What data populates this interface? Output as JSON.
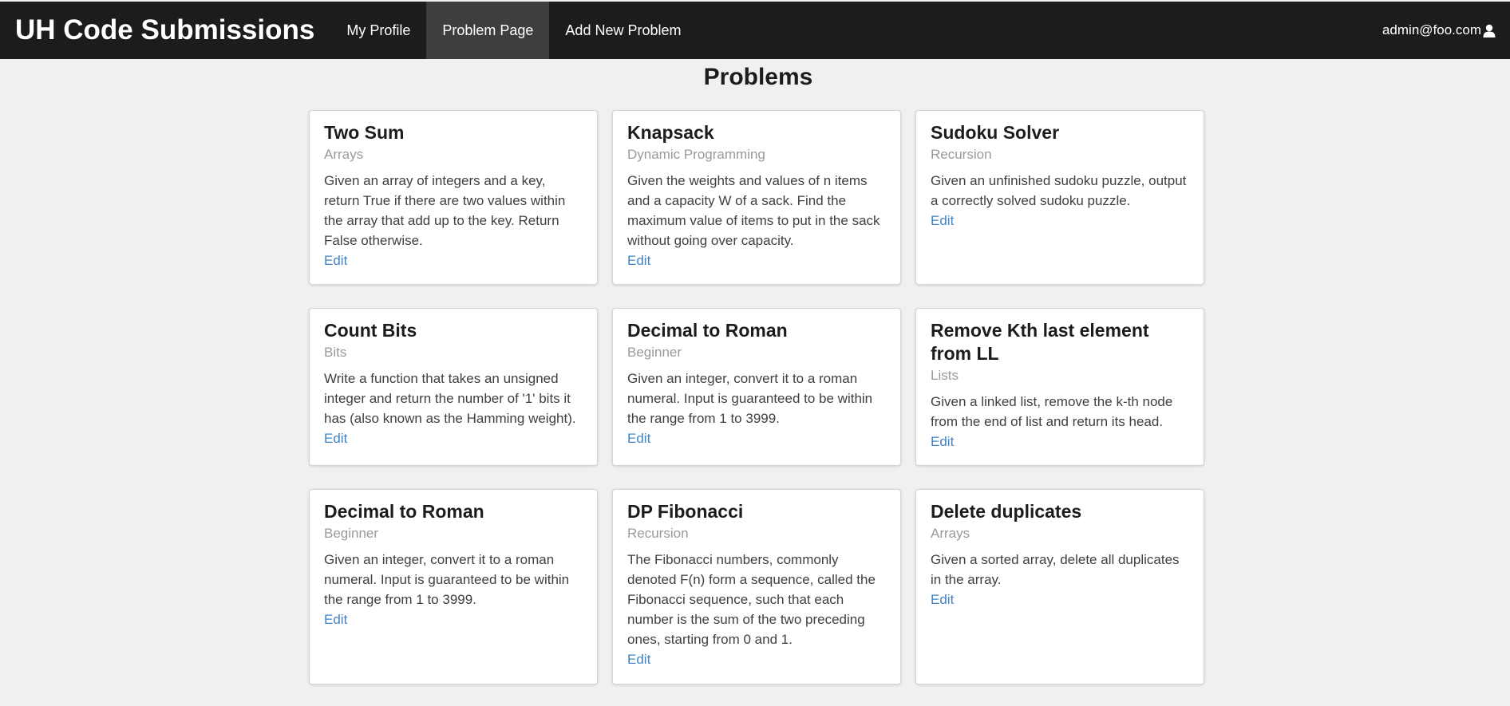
{
  "nav": {
    "brand": "UH Code Submissions",
    "items": [
      {
        "label": "My Profile"
      },
      {
        "label": "Problem Page"
      },
      {
        "label": "Add New Problem"
      }
    ],
    "user_email": "admin@foo.com"
  },
  "page": {
    "title": "Problems"
  },
  "problems": [
    {
      "title": "Two Sum",
      "category": "Arrays",
      "description": "Given an array of integers and a key, return True if there are two values within the array that add up to the key. Return False otherwise.",
      "edit": "Edit"
    },
    {
      "title": "Knapsack",
      "category": "Dynamic Programming",
      "description": "Given the weights and values of n items and a capacity W of a sack. Find the maximum value of items to put in the sack without going over capacity.",
      "edit": "Edit"
    },
    {
      "title": "Sudoku Solver",
      "category": "Recursion",
      "description": "Given an unfinished sudoku puzzle, output a correctly solved sudoku puzzle.",
      "edit": "Edit"
    },
    {
      "title": "Count Bits",
      "category": "Bits",
      "description": "Write a function that takes an unsigned integer and return the number of '1' bits it has (also known as the Hamming weight).",
      "edit": "Edit"
    },
    {
      "title": "Decimal to Roman",
      "category": "Beginner",
      "description": "Given an integer, convert it to a roman numeral. Input is guaranteed to be within the range from 1 to 3999.",
      "edit": "Edit"
    },
    {
      "title": "Remove Kth last element from LL",
      "category": "Lists",
      "description": "Given a linked list, remove the k-th node from the end of list and return its head.",
      "edit": "Edit"
    },
    {
      "title": "Decimal to Roman",
      "category": "Beginner",
      "description": "Given an integer, convert it to a roman numeral. Input is guaranteed to be within the range from 1 to 3999.",
      "edit": "Edit"
    },
    {
      "title": "DP Fibonacci",
      "category": "Recursion",
      "description": "The Fibonacci numbers, commonly denoted F(n) form a sequence, called the Fibonacci sequence, such that each number is the sum of the two preceding ones, starting from 0 and 1.",
      "edit": "Edit"
    },
    {
      "title": "Delete duplicates",
      "category": "Arrays",
      "description": "Given a sorted array, delete all duplicates in the array.",
      "edit": "Edit"
    }
  ],
  "colors": {
    "navbar": "#1b1c1d",
    "active_nav": "#3d3e3f",
    "link": "#4183c4",
    "background": "#f0f0f0"
  },
  "icons": {
    "user": "user-icon"
  }
}
